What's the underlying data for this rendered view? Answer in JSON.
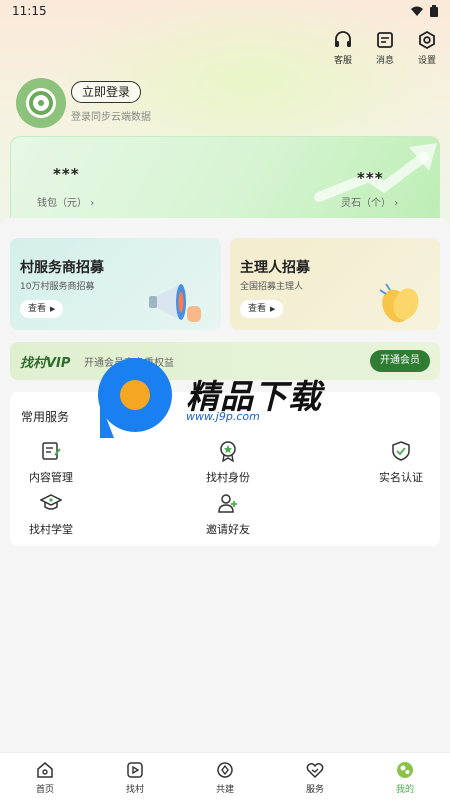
{
  "status": {
    "time": "11:15"
  },
  "header": {
    "actions": [
      {
        "label": "客服",
        "icon": "headset-icon"
      },
      {
        "label": "消息",
        "icon": "message-icon"
      },
      {
        "label": "设置",
        "icon": "gear-icon"
      }
    ]
  },
  "profile": {
    "login_label": "立即登录",
    "login_sub": "登录同步云端数据"
  },
  "wallet": {
    "wallet_value": "***",
    "wallet_label": "钱包（元）",
    "stone_value": "***",
    "stone_label": "灵石（个）",
    "chevron": "›"
  },
  "recruit": [
    {
      "title": "村服务商招募",
      "sub": "10万村服务商招募",
      "btn": "查看"
    },
    {
      "title": "主理人招募",
      "sub": "全国招募主理人",
      "btn": "查看"
    }
  ],
  "vip": {
    "title": "找村VIP",
    "sub": "开通会员享多重权益",
    "btn": "开通会员"
  },
  "services": {
    "title": "常用服务",
    "items": [
      {
        "label": "内容管理",
        "icon": "content-edit-icon"
      },
      {
        "label": "找村身份",
        "icon": "identity-badge-icon"
      },
      {
        "label": "实名认证",
        "icon": "shield-check-icon"
      },
      {
        "label": "找村学堂",
        "icon": "graduation-cap-icon"
      },
      {
        "label": "邀请好友",
        "icon": "invite-user-icon"
      }
    ]
  },
  "watermark": {
    "text": "精品下载",
    "url": "www.j9p.com"
  },
  "nav": [
    {
      "label": "首页",
      "icon": "home-icon"
    },
    {
      "label": "找村",
      "icon": "play-icon"
    },
    {
      "label": "共建",
      "icon": "compass-icon"
    },
    {
      "label": "服务",
      "icon": "heart-hands-icon"
    },
    {
      "label": "我的",
      "icon": "profile-icon"
    }
  ],
  "colors": {
    "accent": "#2e7d32",
    "active_nav": "#4caf50",
    "watermark_blue": "#1a7ff0",
    "watermark_orange": "#f5a623"
  }
}
